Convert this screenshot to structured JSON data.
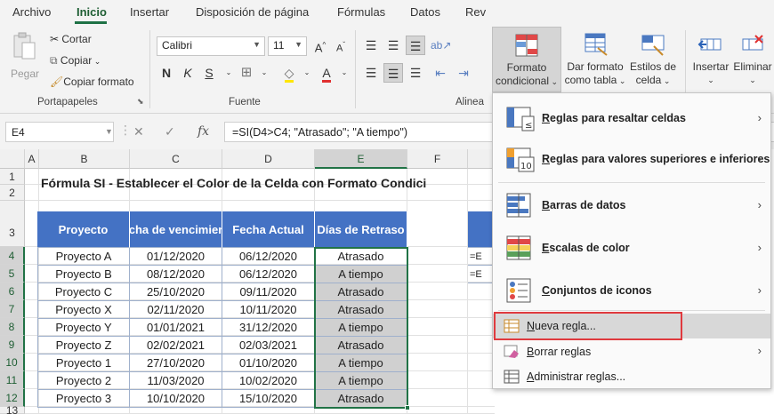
{
  "tabs": [
    "Archivo",
    "Inicio",
    "Insertar",
    "Disposición de página",
    "Fórmulas",
    "Datos",
    "Rev"
  ],
  "ribbon": {
    "clipboard": {
      "paste": "Pegar",
      "cut": "Cortar",
      "copy": "Copiar",
      "format_painter": "Copiar formato",
      "label": "Portapapeles"
    },
    "font": {
      "name": "Calibri",
      "size": "11",
      "label": "Fuente"
    },
    "alignment": {
      "label": "Alinea"
    },
    "styles": {
      "conditional_line1": "Formato",
      "conditional_line2": "condicional",
      "table_line1": "Dar formato",
      "table_line2": "como tabla",
      "cell_styles_line1": "Estilos de",
      "cell_styles_line2": "celda"
    },
    "cells": {
      "insert": "Insertar",
      "delete": "Eliminar"
    }
  },
  "formula_bar": {
    "name_box": "E4",
    "fx": "fx",
    "formula": "=SI(D4>C4; \"Atrasado\"; \"A tiempo\")"
  },
  "sheet": {
    "columns": [
      "A",
      "B",
      "C",
      "D",
      "E",
      "F"
    ],
    "rows": [
      "1",
      "2",
      "3",
      "4",
      "5",
      "6",
      "7",
      "8",
      "9",
      "10",
      "11",
      "12",
      "13"
    ],
    "title": "Fórmula SI - Establecer el Color de la Celda con Formato Condici",
    "headers": [
      "Proyecto",
      "Fecha de vencimiento",
      "Fecha Actual",
      "Días de Retraso"
    ],
    "data": [
      [
        "Proyecto A",
        "01/12/2020",
        "06/12/2020",
        "Atrasado"
      ],
      [
        "Proyecto B",
        "08/12/2020",
        "06/12/2020",
        "A tiempo"
      ],
      [
        "Proyecto C",
        "25/10/2020",
        "09/11/2020",
        "Atrasado"
      ],
      [
        "Proyecto X",
        "02/11/2020",
        "10/11/2020",
        "Atrasado"
      ],
      [
        "Proyecto Y",
        "01/01/2021",
        "31/12/2020",
        "A tiempo"
      ],
      [
        "Proyecto Z",
        "02/02/2021",
        "02/03/2021",
        "Atrasado"
      ],
      [
        "Proyecto 1",
        "27/10/2020",
        "01/10/2020",
        "A tiempo"
      ],
      [
        "Proyecto 2",
        "11/03/2020",
        "10/02/2020",
        "A tiempo"
      ],
      [
        "Proyecto 3",
        "10/10/2020",
        "15/10/2020",
        "Atrasado"
      ]
    ],
    "partial_cells": [
      "=E",
      "=E"
    ],
    "colors": {
      "header_blue": "#4472c4",
      "selection_green": "#217346",
      "highlight_red": "#e03a3e"
    }
  },
  "menu": {
    "items": [
      {
        "pre": "",
        "u": "R",
        "post": "eglas para resaltar celdas"
      },
      {
        "pre": "",
        "u": "R",
        "post": "eglas para valores superiores e inferiores"
      },
      {
        "pre": "",
        "u": "B",
        "post": "arras de datos"
      },
      {
        "pre": "",
        "u": "E",
        "post": "scalas de color"
      },
      {
        "pre": "",
        "u": "C",
        "post": "onjuntos de iconos"
      },
      {
        "pre": "",
        "u": "N",
        "post": "ueva regla..."
      },
      {
        "pre": "",
        "u": "B",
        "post": "orrar reglas"
      },
      {
        "pre": "",
        "u": "A",
        "post": "dministrar reglas..."
      }
    ],
    "icon_number": "10"
  }
}
